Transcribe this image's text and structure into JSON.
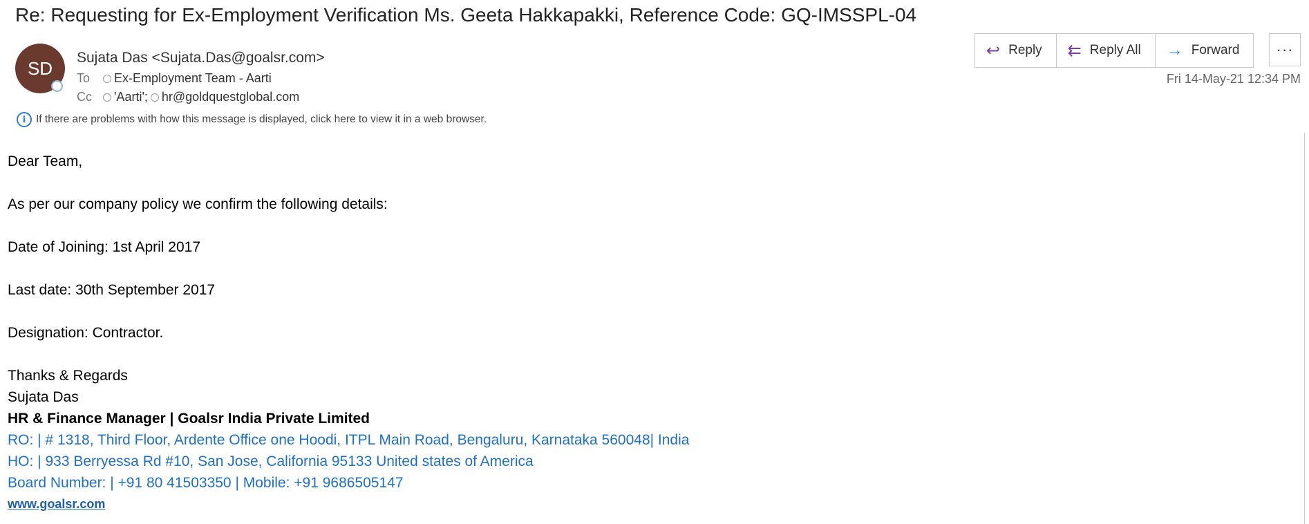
{
  "email": {
    "subject": "Re: Requesting for Ex-Employment Verification Ms. Geeta Hakkapakki, Reference Code: GQ-IMSSPL-04",
    "avatar_initials": "SD",
    "sender": "Sujata Das <Sujata.Das@goalsr.com>",
    "to_label": "To",
    "to": [
      "Ex-Employment Team - Aarti"
    ],
    "cc_label": "Cc",
    "cc": [
      "'Aarti';",
      "hr@goldquestglobal.com"
    ],
    "info_message": "If there are problems with how this message is displayed, click here to view it in a web browser.",
    "date": "Fri 14-May-21 12:34 PM"
  },
  "actions": {
    "reply": "Reply",
    "reply_all": "Reply All",
    "forward": "Forward",
    "more": "···"
  },
  "body": {
    "greeting": "Dear Team,",
    "intro": "As per our company policy we confirm the following details:",
    "joining": "Date of Joining: 1st April 2017",
    "last_date": "Last date: 30th September 2017",
    "designation": "Designation: Contractor.",
    "closing": "Thanks & Regards",
    "name": "Sujata Das",
    "title": "HR & Finance Manager |  Goalsr India Private Limited",
    "ro": "RO: | # 1318, Third Floor, Ardente Office one Hoodi, ITPL Main Road, Bengaluru, Karnataka 560048| India",
    "ho": "HO: | 933 Berryessa Rd #10, San Jose, California 95133 United states of America",
    "board": "Board Number:  | +91 80 41503350 | Mobile: +91 9686505147",
    "website": "www.goalsr.com"
  },
  "colors": {
    "avatar": "#6b3a2f",
    "accent_reply": "#7a3fa0",
    "accent_forward": "#2b7cd3",
    "signature_blue": "#1f6fc5"
  },
  "icons": {
    "reply": "reply-arrow-icon",
    "reply_all": "reply-all-arrow-icon",
    "forward": "forward-arrow-icon",
    "info": "info-icon",
    "more": "ellipsis-icon"
  }
}
